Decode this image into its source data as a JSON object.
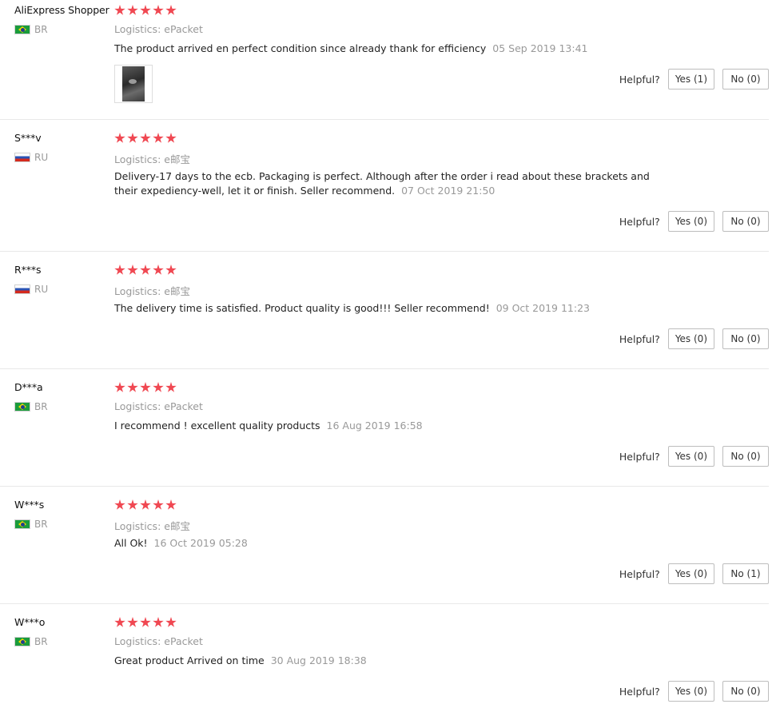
{
  "helpful_label": "Helpful?",
  "colors": {
    "star": "#f04852",
    "muted_text": "#999999",
    "divider": "#e8e8e8"
  },
  "reviews": [
    {
      "user": "AliExpress Shopper",
      "country": "BR",
      "flag_icon": "brazil-flag-icon",
      "rating": 5,
      "logistics_label": "Logistics:",
      "logistics_value": "ePacket",
      "text": "The product arrived en perfect condition since already thank for efficiency",
      "date": "05 Sep 2019 13:41",
      "has_photo": true,
      "yes": "Yes (1)",
      "no": "No (0)"
    },
    {
      "user": "S***v",
      "country": "RU",
      "flag_icon": "russia-flag-icon",
      "rating": 5,
      "logistics_label": "Logistics:",
      "logistics_value": "e邮宝",
      "text": "Delivery-17 days to the ecb. Packaging is perfect. Although after the order i read about these brackets and their expediency-well, let it or finish. Seller recommend.",
      "date": "07 Oct 2019 21:50",
      "has_photo": false,
      "yes": "Yes (0)",
      "no": "No (0)"
    },
    {
      "user": "R***s",
      "country": "RU",
      "flag_icon": "russia-flag-icon",
      "rating": 5,
      "logistics_label": "Logistics:",
      "logistics_value": "e邮宝",
      "text": "The delivery time is satisfied. Product quality is good!!! Seller recommend!",
      "date": "09 Oct 2019 11:23",
      "has_photo": false,
      "yes": "Yes (0)",
      "no": "No (0)"
    },
    {
      "user": "D***a",
      "country": "BR",
      "flag_icon": "brazil-flag-icon",
      "rating": 5,
      "logistics_label": "Logistics:",
      "logistics_value": "ePacket",
      "text": "I recommend ! excellent quality products",
      "date": "16 Aug 2019 16:58",
      "has_photo": false,
      "yes": "Yes (0)",
      "no": "No (0)"
    },
    {
      "user": "W***s",
      "country": "BR",
      "flag_icon": "brazil-flag-icon",
      "rating": 5,
      "logistics_label": "Logistics:",
      "logistics_value": "e邮宝",
      "text": "All Ok!",
      "date": "16 Oct 2019 05:28",
      "has_photo": false,
      "yes": "Yes (0)",
      "no": "No (1)"
    },
    {
      "user": "W***o",
      "country": "BR",
      "flag_icon": "brazil-flag-icon",
      "rating": 5,
      "logistics_label": "Logistics:",
      "logistics_value": "ePacket",
      "text": "Great product Arrived on time",
      "date": "30 Aug 2019 18:38",
      "has_photo": false,
      "yes": "Yes (0)",
      "no": "No (0)"
    }
  ]
}
